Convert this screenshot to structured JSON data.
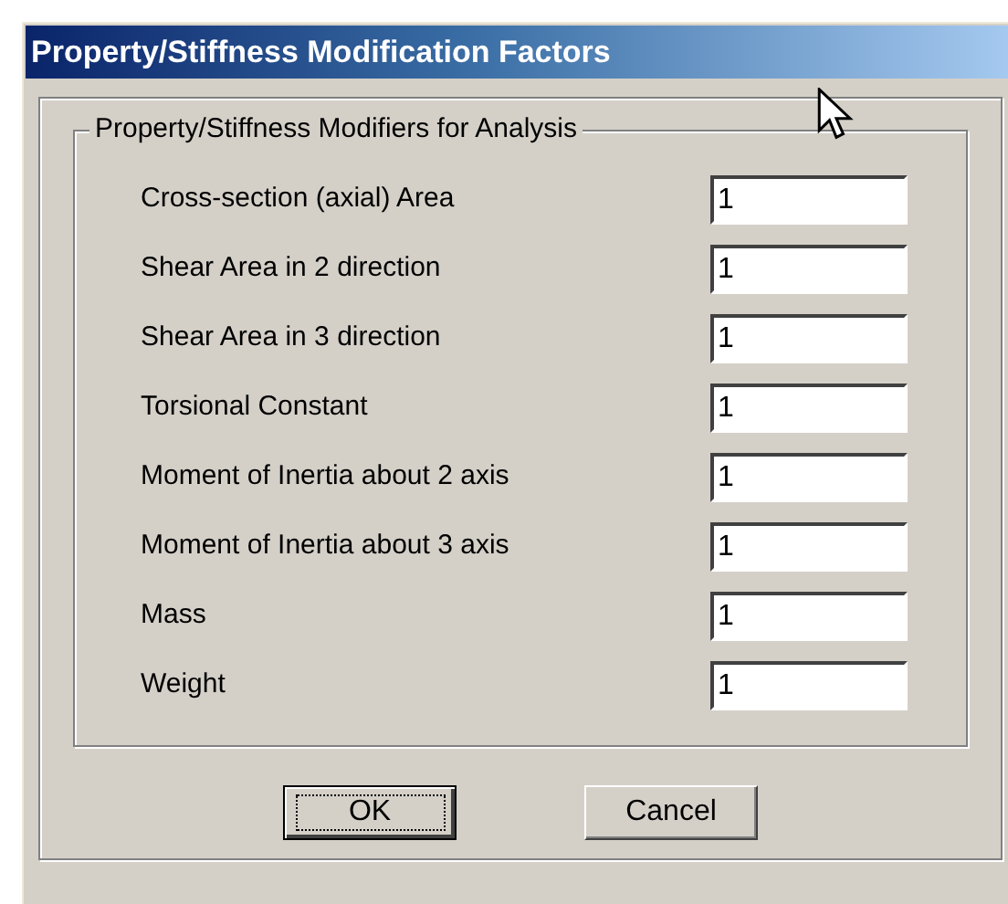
{
  "window": {
    "title": "Property/Stiffness Modification Factors"
  },
  "group": {
    "title": "Property/Stiffness Modifiers for Analysis",
    "fields": [
      {
        "label": "Cross-section (axial) Area",
        "value": "1"
      },
      {
        "label": "Shear Area in 2 direction",
        "value": "1"
      },
      {
        "label": "Shear Area in 3 direction",
        "value": "1"
      },
      {
        "label": "Torsional Constant",
        "value": "1"
      },
      {
        "label": "Moment of Inertia about 2 axis",
        "value": "1"
      },
      {
        "label": "Moment of Inertia about 3 axis",
        "value": "1"
      },
      {
        "label": "Mass",
        "value": "1"
      },
      {
        "label": "Weight",
        "value": "1"
      }
    ]
  },
  "buttons": [
    {
      "label": "OK",
      "focused": true
    },
    {
      "label": "Cancel",
      "focused": false
    }
  ]
}
